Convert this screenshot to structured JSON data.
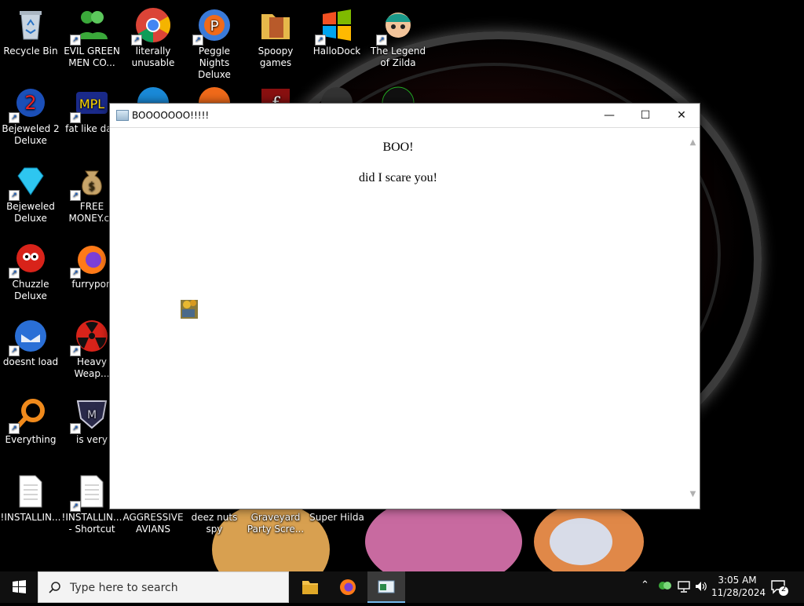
{
  "desktop": {
    "icons": [
      {
        "label": "Recycle Bin"
      },
      {
        "label": "EVIL GREEN MEN CO..."
      },
      {
        "label": "literally unusable"
      },
      {
        "label": "Peggle Nights Deluxe"
      },
      {
        "label": "Spoopy games"
      },
      {
        "label": "HalloDock"
      },
      {
        "label": "The Legend of Zilda"
      },
      {
        "label": "Bejeweled 2 Deluxe"
      },
      {
        "label": "fat like darl"
      },
      {
        "label": "Bejeweled Deluxe"
      },
      {
        "label": "FREE MONEY.co"
      },
      {
        "label": "Chuzzle Deluxe"
      },
      {
        "label": "furrypon"
      },
      {
        "label": "doesnt load"
      },
      {
        "label": "Heavy Weap..."
      },
      {
        "label": "Everything"
      },
      {
        "label": "is very"
      },
      {
        "label": "!INSTALLIN..."
      },
      {
        "label": "!INSTALLIN... - Shortcut"
      },
      {
        "label": "AGGRESSIVE AVIANS"
      },
      {
        "label": "deez nuts spy"
      },
      {
        "label": "Graveyard Party Scre..."
      },
      {
        "label": "Super Hilda"
      }
    ]
  },
  "window": {
    "title": "BOOOOOOO!!!!!",
    "controls": {
      "minimize": "—",
      "maximize": "☐",
      "close": "✕"
    },
    "content": {
      "heading": "BOO!",
      "message": "did I scare you!"
    }
  },
  "taskbar": {
    "search_placeholder": "Type here to search",
    "apps": [
      "file-explorer",
      "firefox",
      "boo-window"
    ],
    "time": "3:05 AM",
    "date": "11/28/2024",
    "notification_count": "2"
  },
  "colors": {
    "accent": "#0078d7",
    "taskbar": "#101010",
    "window_bg": "#ffffff"
  }
}
